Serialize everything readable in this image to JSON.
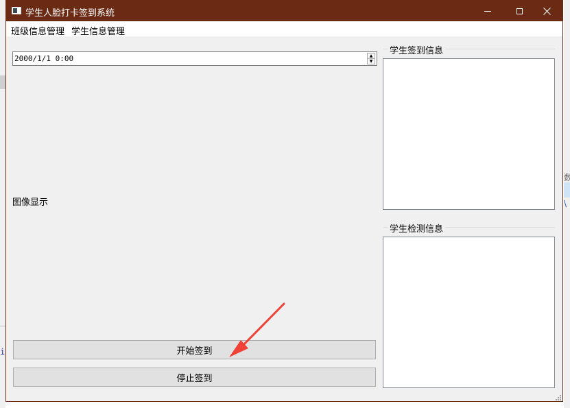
{
  "window": {
    "title": "学生人脸打卡签到系统"
  },
  "menu": {
    "class_info": "班级信息管理",
    "student_info": "学生信息管理"
  },
  "datetime": {
    "value": "2000/1/1 0:00"
  },
  "image_area": {
    "label": "图像显示"
  },
  "buttons": {
    "start": "开始签到",
    "stop": "停止签到"
  },
  "groups": {
    "sign_info": "学生签到信息",
    "detect_info": "学生检测信息"
  },
  "background": {
    "left_text": "i",
    "right_char": "数",
    "right_slash": "\\"
  },
  "colors": {
    "titlebar": "#6b2a14",
    "annotation_arrow": "#ef4136"
  },
  "icons": [
    "app-icon",
    "minimize-icon",
    "maximize-icon",
    "close-icon",
    "spin-up-icon",
    "spin-down-icon",
    "size-grip-icon",
    "annotation-arrow"
  ]
}
